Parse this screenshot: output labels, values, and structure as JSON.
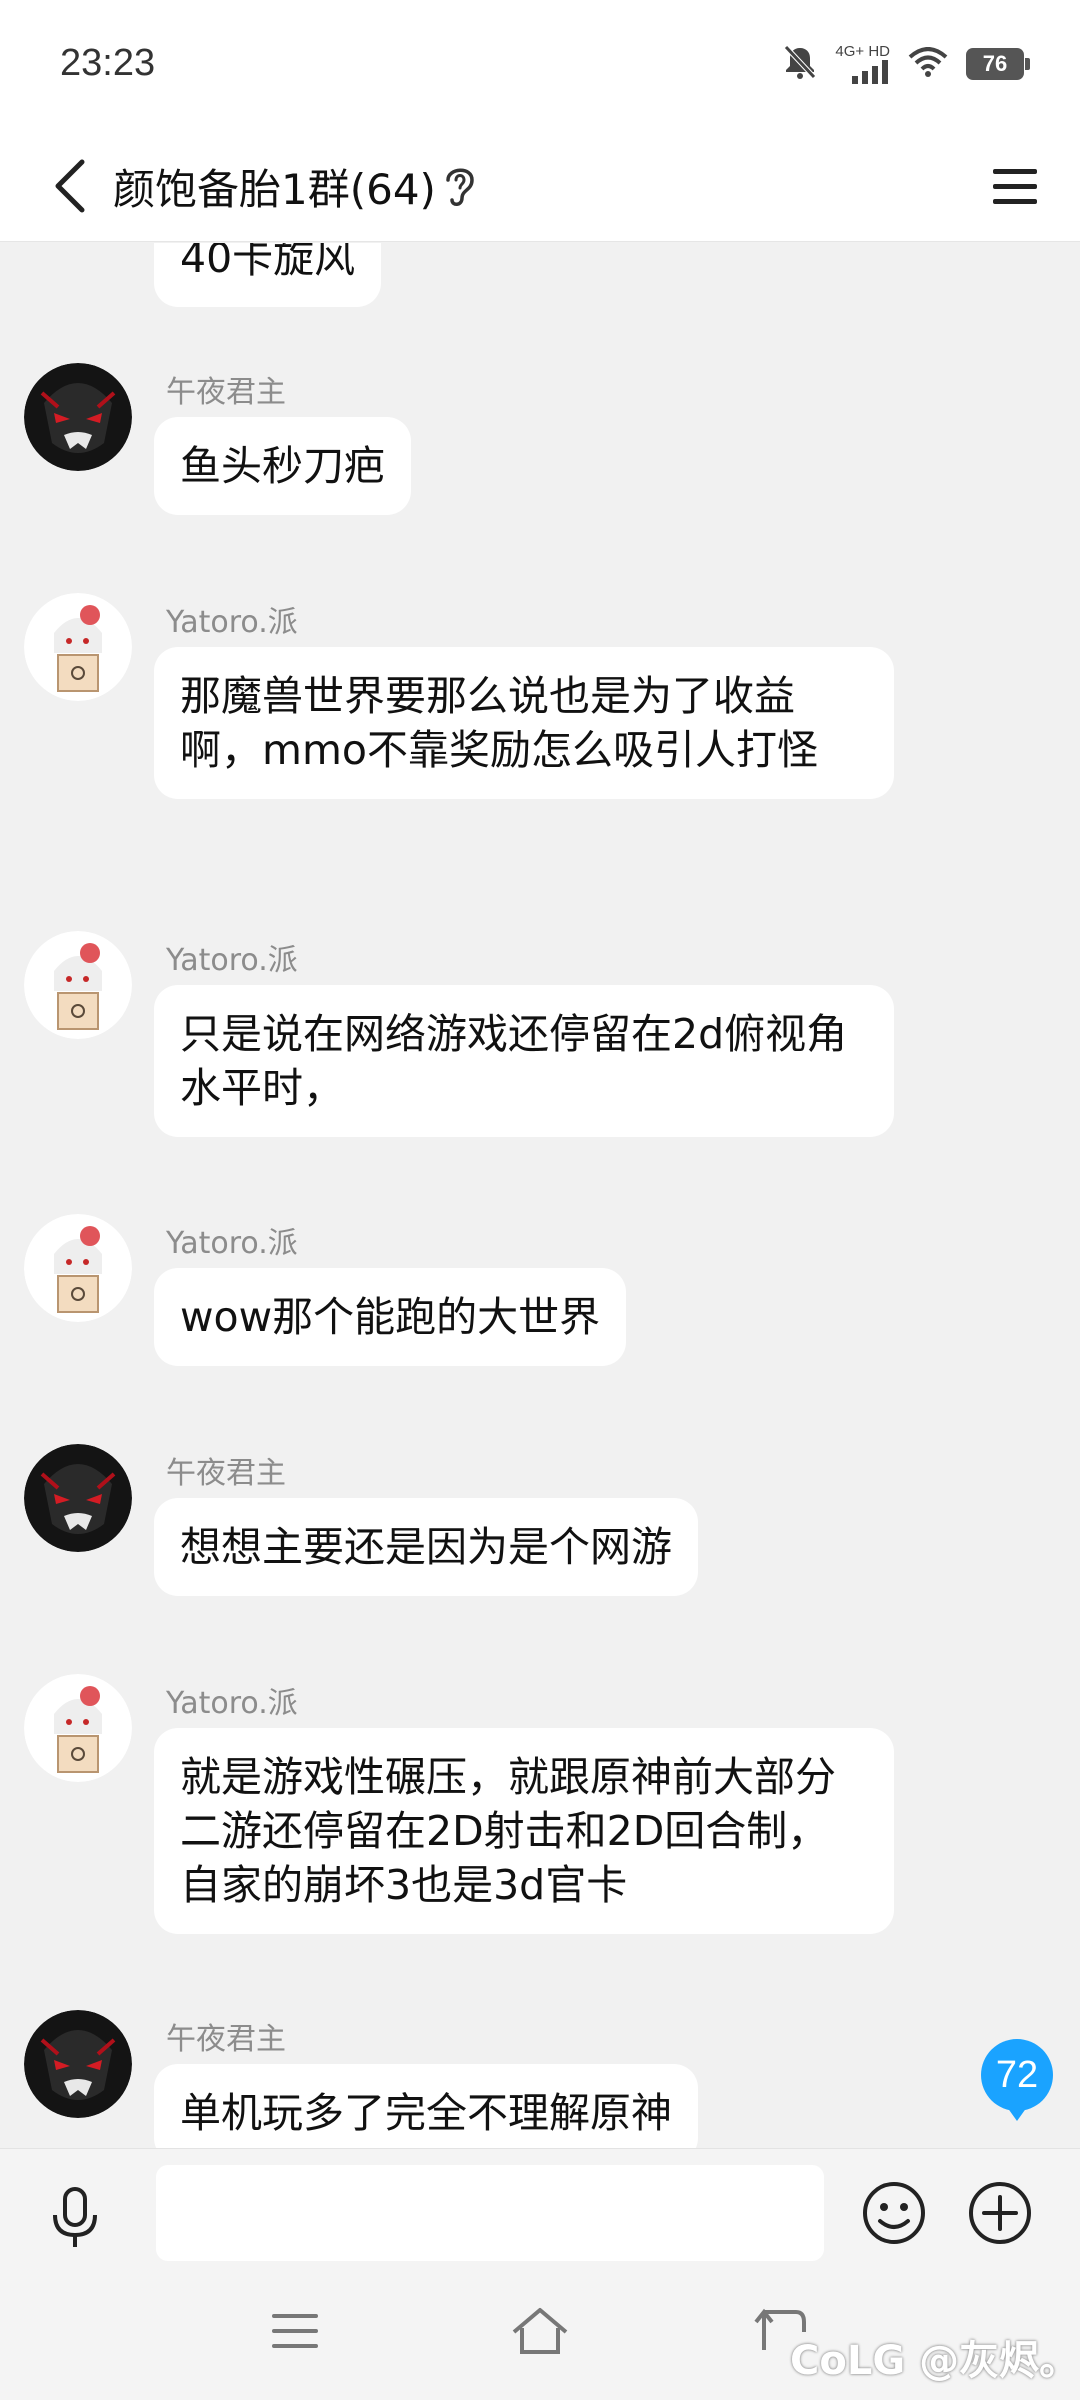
{
  "status_bar": {
    "time": "23:23",
    "network_label": "4G+ HD",
    "battery": "76",
    "icons": [
      "bell-off-icon",
      "signal-icon",
      "wifi-icon",
      "battery-icon"
    ]
  },
  "header": {
    "title": "颜饱备胎1群(64)",
    "back_icon": "chevron-left-icon",
    "ear_icon": "ear-icon",
    "menu_icon": "hamburger-menu-icon"
  },
  "messages": [
    {
      "sender": "",
      "avatar": "",
      "text": "40卡旋风"
    },
    {
      "sender": "午夜君主",
      "avatar": "dark-red-eyes-avatar",
      "text": "鱼头秒刀疤"
    },
    {
      "sender": "Yatoro.派",
      "avatar": "anime-girl-box-avatar",
      "text": "那魔兽世界要那么说也是为了收益啊，mmo不靠奖励怎么吸引人打怪"
    },
    {
      "sender": "Yatoro.派",
      "avatar": "anime-girl-box-avatar",
      "text": "只是说在网络游戏还停留在2d俯视角水平时，"
    },
    {
      "sender": "Yatoro.派",
      "avatar": "anime-girl-box-avatar",
      "text": "wow那个能跑的大世界"
    },
    {
      "sender": "午夜君主",
      "avatar": "dark-red-eyes-avatar",
      "text": "想想主要还是因为是个网游"
    },
    {
      "sender": "Yatoro.派",
      "avatar": "anime-girl-box-avatar",
      "text": "就是游戏性碾压，就跟原神前大部分二游还停留在2D射击和2D回合制，自家的崩坏3也是3d官卡"
    },
    {
      "sender": "午夜君主",
      "avatar": "dark-red-eyes-avatar",
      "text": "单机玩多了完全不理解原神"
    }
  ],
  "unread_count": "72",
  "input": {
    "placeholder": "",
    "value": ""
  },
  "bottom_nav": {
    "icons": [
      "menu-lines-icon",
      "home-icon",
      "back-icon"
    ]
  },
  "watermark": "CoLG @灰烬。",
  "colors": {
    "background": "#f1f1f1",
    "bubble": "#ffffff",
    "badge": "#1aa3ff"
  }
}
